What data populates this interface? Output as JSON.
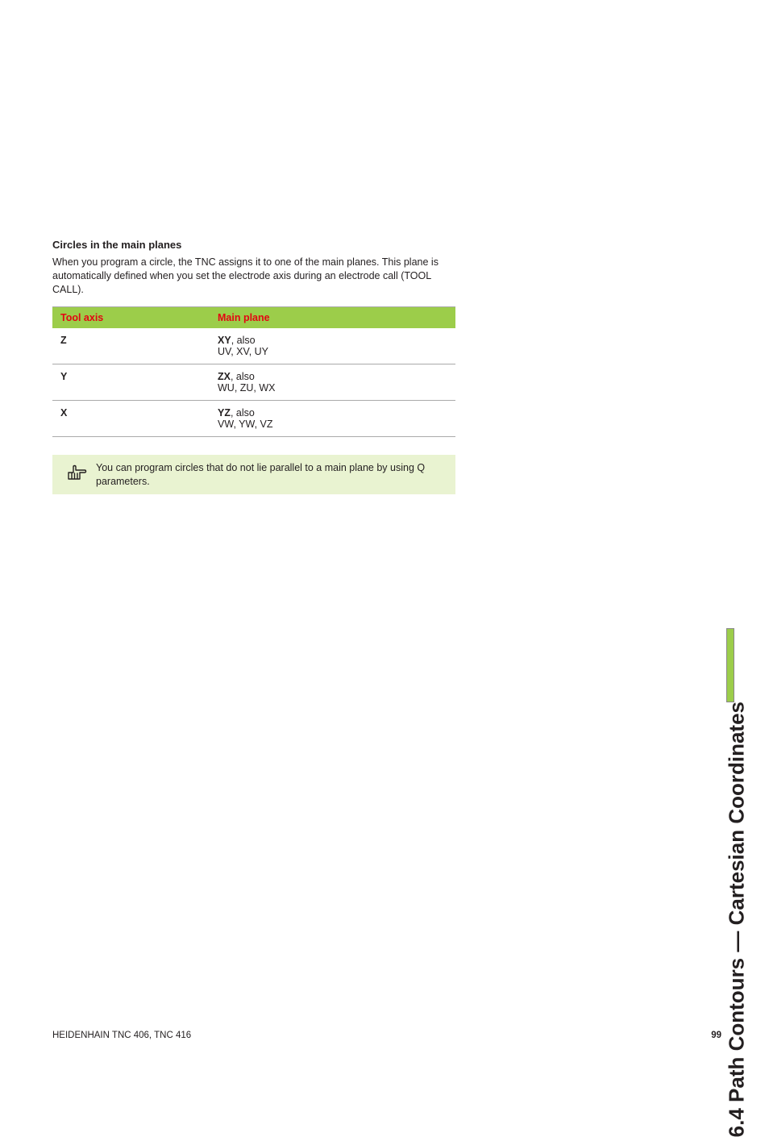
{
  "section": {
    "subheading": "Circles in the main planes",
    "paragraph": "When you program a circle, the TNC assigns it to one of the main planes. This plane is automatically defined when you set the electrode axis during an electrode call (TOOL CALL)."
  },
  "table": {
    "headers": {
      "col1": "Tool axis",
      "col2": "Main plane"
    },
    "rows": [
      {
        "axis": "Z",
        "plane_bold": "XY",
        "plane_rest": ", also",
        "plane_line2": "UV, XV, UY"
      },
      {
        "axis": "Y",
        "plane_bold": "ZX",
        "plane_rest": ", also",
        "plane_line2": "WU, ZU, WX"
      },
      {
        "axis": "X",
        "plane_bold": "YZ",
        "plane_rest": ", also",
        "plane_line2": "VW, YW, VZ"
      }
    ]
  },
  "note": {
    "text": "You can program circles that do not lie parallel to a main plane by using Q parameters."
  },
  "side": {
    "label": "6.4 Path Contours — Cartesian Coordinates"
  },
  "footer": {
    "left": "HEIDENHAIN TNC 406, TNC 416",
    "page": "99"
  }
}
